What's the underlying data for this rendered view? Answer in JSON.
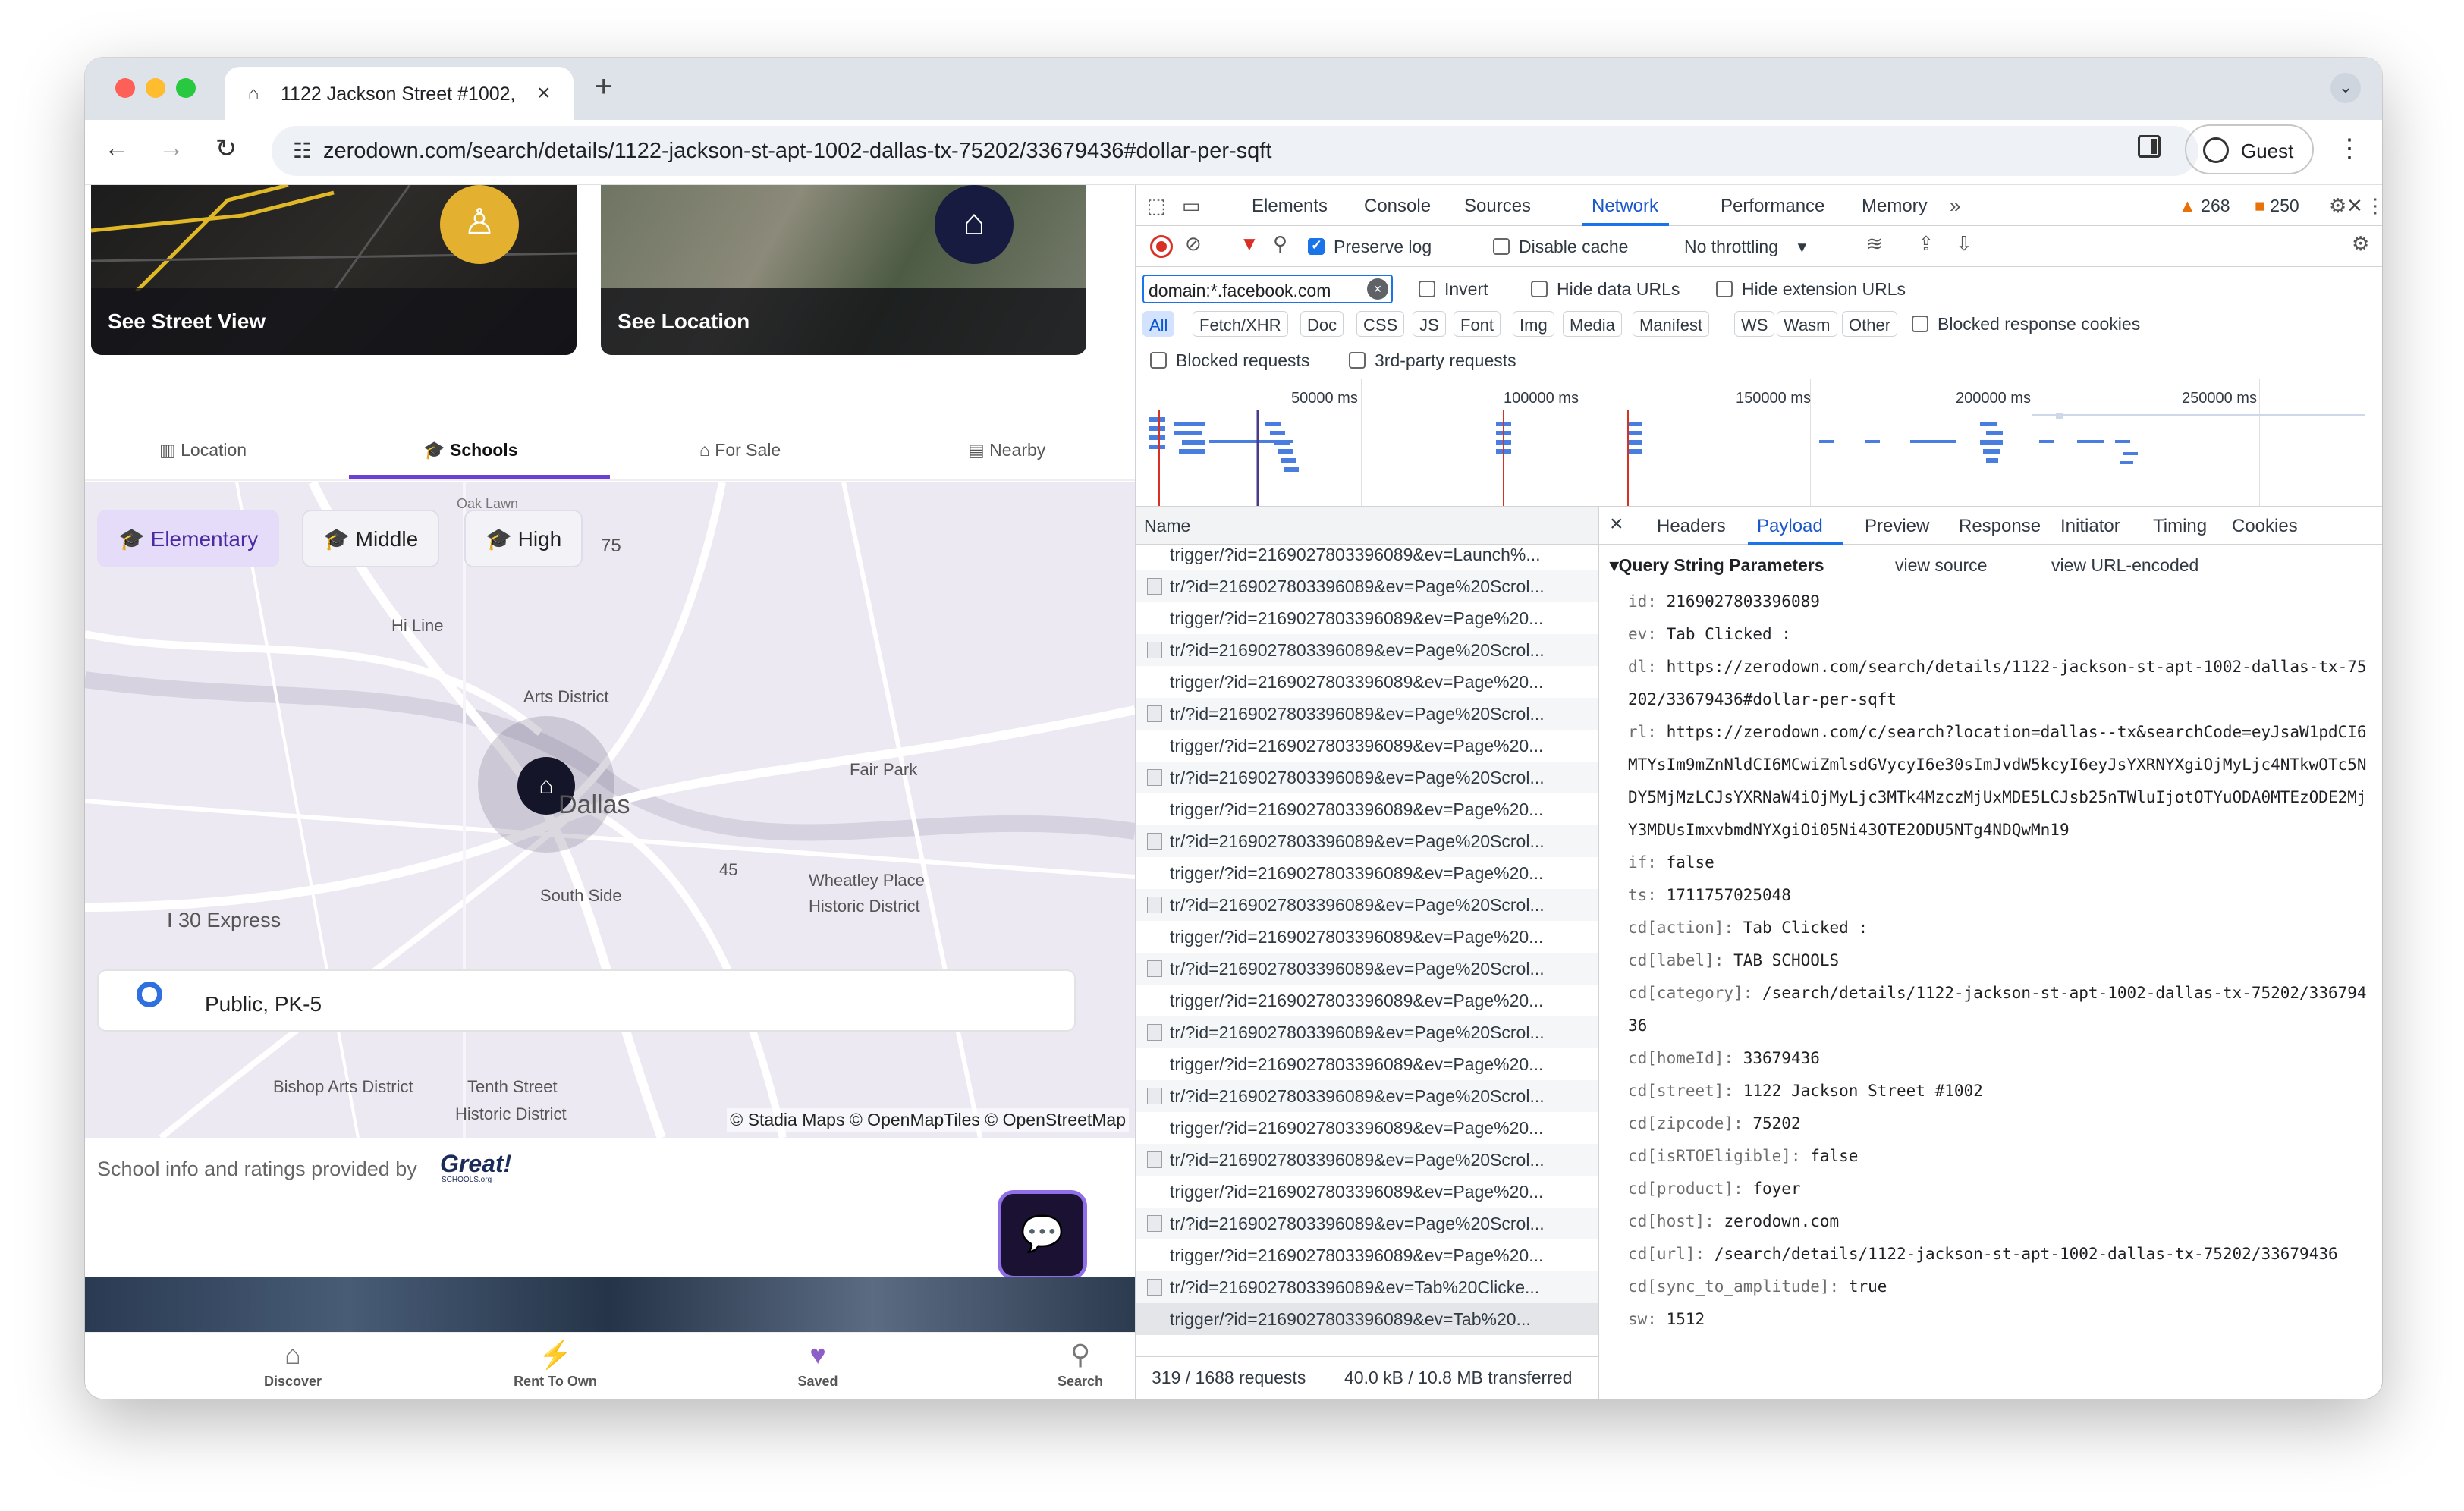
{
  "browser": {
    "tab_title": "1122 Jackson Street #1002,",
    "url": "zerodown.com/search/details/1122-jackson-st-apt-1002-dallas-tx-75202/33679436#dollar-per-sqft",
    "guest_label": "Guest"
  },
  "page": {
    "street_view_label": "See Street View",
    "location_label": "See Location",
    "tabs": [
      "Location",
      "Schools",
      "For Sale",
      "Nearby"
    ],
    "chips": [
      "Elementary",
      "Middle",
      "High"
    ],
    "map_labels": [
      "Hi Line",
      "Arts District",
      "Fair Park",
      "Dallas",
      "45",
      "South Side",
      "Wheatley Place",
      "Historic District",
      "I 30 Express",
      "Bishop Arts District",
      "Tenth Street",
      "Historic District",
      "75",
      "Oak Lawn"
    ],
    "school_summary": "Public, PK-5",
    "attribution": "© Stadia Maps © OpenMapTiles © OpenStreetMap",
    "credits": "School info and ratings provided by",
    "gs_logo": "Great!",
    "gs_sub": "SCHOOLS.org",
    "bottom_nav": [
      "Discover",
      "Rent To Own",
      "Saved",
      "Search"
    ]
  },
  "devtools": {
    "tabs": [
      "Elements",
      "Console",
      "Sources",
      "Network",
      "Performance",
      "Memory"
    ],
    "warnings": "268",
    "errors": "250",
    "preserve_log": "Preserve log",
    "disable_cache": "Disable cache",
    "throttling": "No throttling",
    "filter_value": "domain:*.facebook.com",
    "invert": "Invert",
    "hide_data_urls": "Hide data URLs",
    "hide_ext_urls": "Hide extension URLs",
    "types": [
      "All",
      "Fetch/XHR",
      "Doc",
      "CSS",
      "JS",
      "Font",
      "Img",
      "Media",
      "Manifest",
      "WS",
      "Wasm",
      "Other"
    ],
    "blocked_cookies": "Blocked response cookies",
    "blocked_requests": "Blocked requests",
    "third_party": "3rd-party requests",
    "overview_ticks": [
      "50000 ms",
      "100000 ms",
      "150000 ms",
      "200000 ms",
      "250000 ms"
    ],
    "name_header": "Name",
    "requests": [
      "trigger/?id=2169027803396089&ev=Launch%...",
      "tr/?id=2169027803396089&ev=Page%20Scrol...",
      "trigger/?id=2169027803396089&ev=Page%20...",
      "tr/?id=2169027803396089&ev=Page%20Scrol...",
      "trigger/?id=2169027803396089&ev=Page%20...",
      "tr/?id=2169027803396089&ev=Page%20Scrol...",
      "trigger/?id=2169027803396089&ev=Page%20...",
      "tr/?id=2169027803396089&ev=Page%20Scrol...",
      "trigger/?id=2169027803396089&ev=Page%20...",
      "tr/?id=2169027803396089&ev=Page%20Scrol...",
      "trigger/?id=2169027803396089&ev=Page%20...",
      "tr/?id=2169027803396089&ev=Page%20Scrol...",
      "trigger/?id=2169027803396089&ev=Page%20...",
      "tr/?id=2169027803396089&ev=Page%20Scrol...",
      "trigger/?id=2169027803396089&ev=Page%20...",
      "tr/?id=2169027803396089&ev=Page%20Scrol...",
      "trigger/?id=2169027803396089&ev=Page%20...",
      "tr/?id=2169027803396089&ev=Page%20Scrol...",
      "trigger/?id=2169027803396089&ev=Page%20...",
      "tr/?id=2169027803396089&ev=Page%20Scrol...",
      "trigger/?id=2169027803396089&ev=Page%20...",
      "tr/?id=2169027803396089&ev=Page%20Scrol...",
      "trigger/?id=2169027803396089&ev=Page%20...",
      "tr/?id=2169027803396089&ev=Tab%20Clicke...",
      "trigger/?id=2169027803396089&ev=Tab%20..."
    ],
    "status_requests": "319 / 1688 requests",
    "status_transferred": "40.0 kB / 10.8 MB transferred",
    "detail_tabs": [
      "Headers",
      "Payload",
      "Preview",
      "Response",
      "Initiator",
      "Timing",
      "Cookies"
    ],
    "qsp_title": "Query String Parameters",
    "view_source": "view source",
    "view_url_encoded": "view URL-encoded",
    "params": [
      {
        "k": "id:",
        "v": "2169027803396089"
      },
      {
        "k": "ev:",
        "v": "Tab Clicked :"
      },
      {
        "k": "dl:",
        "v": "https://zerodown.com/search/details/1122-jackson-st-apt-1002-dallas-tx-75202/33679436#dollar-per-sqft"
      },
      {
        "k": "rl:",
        "v": "https://zerodown.com/c/search?location=dallas--tx&searchCode=eyJsaW1pdCI6MTYsIm9mZnNldCI6MCwiZmlsdGVycyI6e30sImJvdW5kcyI6eyJsYXRNYXgiOjMyLjc4NTkwOTc5NDY5MjMzLCJsYXRNaW4iOjMyLjc3MTk4MzczMjUxMDE5LCJsb25nTWluIjotOTYuODA0MTEzODE2MjY3MDUsImxvbmdNYXgiOi05Ni43OTE2ODU5NTg4NDQwMn19"
      },
      {
        "k": "if:",
        "v": "false"
      },
      {
        "k": "ts:",
        "v": "1711757025048"
      },
      {
        "k": "cd[action]:",
        "v": "Tab Clicked :"
      },
      {
        "k": "cd[label]:",
        "v": "TAB_SCHOOLS"
      },
      {
        "k": "cd[category]:",
        "v": "/search/details/1122-jackson-st-apt-1002-dallas-tx-75202/33679436"
      },
      {
        "k": "cd[homeId]:",
        "v": "33679436"
      },
      {
        "k": "cd[street]:",
        "v": "1122 Jackson Street #1002"
      },
      {
        "k": "cd[zipcode]:",
        "v": "75202"
      },
      {
        "k": "cd[isRTOEligible]:",
        "v": "false"
      },
      {
        "k": "cd[product]:",
        "v": "foyer"
      },
      {
        "k": "cd[host]:",
        "v": "zerodown.com"
      },
      {
        "k": "cd[url]:",
        "v": "/search/details/1122-jackson-st-apt-1002-dallas-tx-75202/33679436"
      },
      {
        "k": "cd[sync_to_amplitude]:",
        "v": "true"
      },
      {
        "k": "sw:",
        "v": "1512"
      }
    ]
  }
}
